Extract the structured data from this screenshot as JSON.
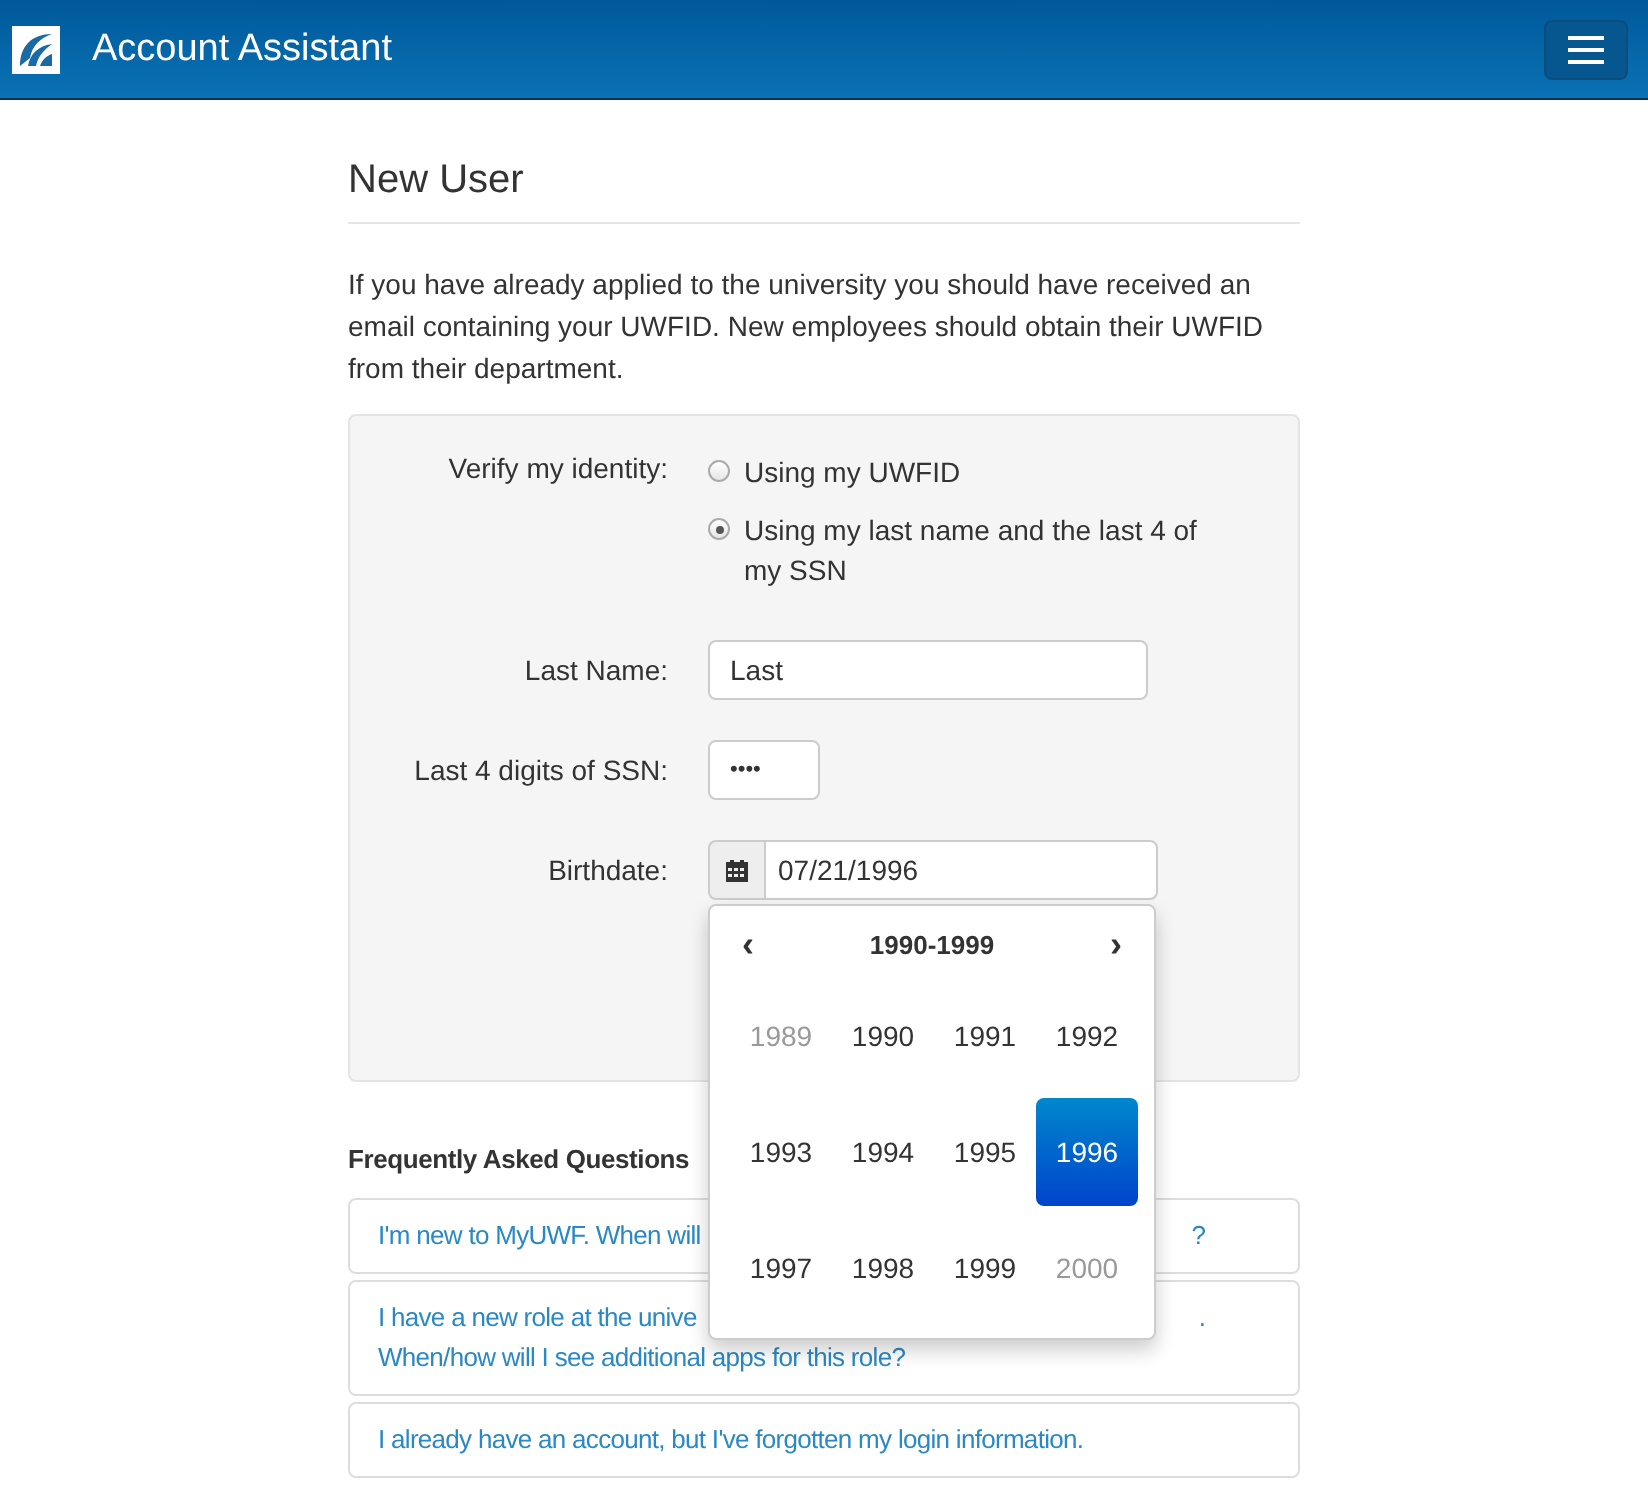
{
  "header": {
    "title": "Account Assistant"
  },
  "page": {
    "heading": "New User",
    "intro": "If you have already applied to the university you should have received an email containing your UWFID. New employees should obtain their UWFID from their department."
  },
  "form": {
    "identity_label": "Verify my identity:",
    "options": [
      {
        "label": "Using my UWFID",
        "selected": false
      },
      {
        "label": "Using my last name and the last 4 of my SSN",
        "selected": true
      }
    ],
    "fields": [
      {
        "kind": "text",
        "label": "Last Name:",
        "value": "Last"
      },
      {
        "kind": "password",
        "label": "Last 4 digits of SSN:",
        "value": "••••"
      },
      {
        "kind": "date",
        "label": "Birthdate:",
        "value": "07/21/1996"
      }
    ]
  },
  "datepicker": {
    "prev": "‹",
    "range": "1990-1999",
    "next": "›",
    "years": [
      {
        "label": "1989",
        "muted": true,
        "selected": false
      },
      {
        "label": "1990",
        "muted": false,
        "selected": false
      },
      {
        "label": "1991",
        "muted": false,
        "selected": false
      },
      {
        "label": "1992",
        "muted": false,
        "selected": false
      },
      {
        "label": "1993",
        "muted": false,
        "selected": false
      },
      {
        "label": "1994",
        "muted": false,
        "selected": false
      },
      {
        "label": "1995",
        "muted": false,
        "selected": false
      },
      {
        "label": "1996",
        "muted": false,
        "selected": true
      },
      {
        "label": "1997",
        "muted": false,
        "selected": false
      },
      {
        "label": "1998",
        "muted": false,
        "selected": false
      },
      {
        "label": "1999",
        "muted": false,
        "selected": false
      },
      {
        "label": "2000",
        "muted": true,
        "selected": false
      }
    ]
  },
  "faq": {
    "heading": "Frequently Asked Questions",
    "items": [
      {
        "lines": [
          {
            "text": "I'm new to MyUWF. When will",
            "tail": "?"
          }
        ]
      },
      {
        "lines": [
          {
            "text": "I have a new role at the unive",
            "tail": "."
          },
          {
            "text": "When/how will I see additional apps for this role?"
          }
        ]
      },
      {
        "lines": [
          {
            "text": "I already have an account, but I've forgotten my login information."
          }
        ]
      }
    ]
  }
}
